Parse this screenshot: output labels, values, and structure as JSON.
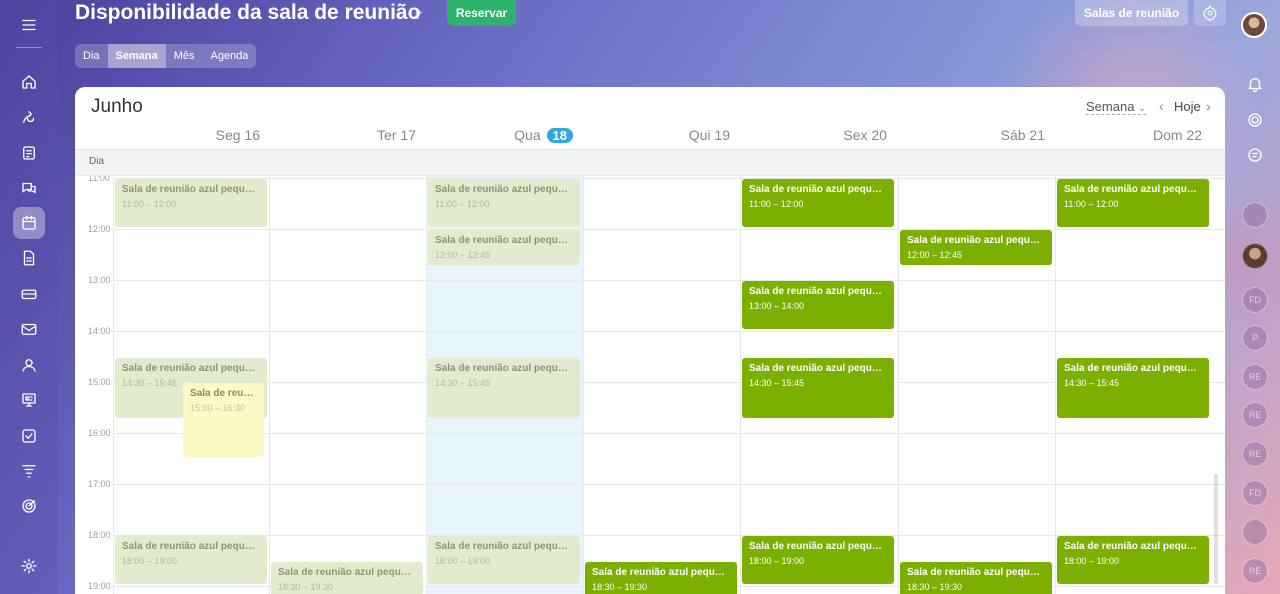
{
  "header": {
    "title": "Disponibilidade da sala de reunião",
    "reserve_label": "Reservar",
    "rooms_label": "Salas de reunião"
  },
  "view_tabs": [
    {
      "label": "Dia"
    },
    {
      "label": "Semana",
      "active": true
    },
    {
      "label": "Mês"
    },
    {
      "label": "Agenda"
    }
  ],
  "calendar": {
    "month": "Junho",
    "view_select": "Semana",
    "today_label": "Hoje",
    "allday_label": "Dia",
    "days": [
      {
        "name": "Seg",
        "num": "16"
      },
      {
        "name": "Ter",
        "num": "17"
      },
      {
        "name": "Qua",
        "num": "18",
        "today": true
      },
      {
        "name": "Qui",
        "num": "19"
      },
      {
        "name": "Sex",
        "num": "20"
      },
      {
        "name": "Sáb",
        "num": "21"
      },
      {
        "name": "Dom",
        "num": "22"
      }
    ],
    "hours": [
      "11:00",
      "12:00",
      "13:00",
      "14:00",
      "15:00",
      "16:00",
      "17:00",
      "18:00",
      "19:00"
    ],
    "events": [
      {
        "day": 0,
        "start": 11.0,
        "end": 12.0,
        "title": "Sala de reunião azul pequen...",
        "time": "11:00 – 12:00",
        "status": "past"
      },
      {
        "day": 2,
        "start": 11.0,
        "end": 12.0,
        "title": "Sala de reunião azul pequen...",
        "time": "11:00 – 12:00",
        "status": "past"
      },
      {
        "day": 4,
        "start": 11.0,
        "end": 12.0,
        "title": "Sala de reunião azul pequen...",
        "time": "11:00 – 12:00",
        "status": "green"
      },
      {
        "day": 6,
        "start": 11.0,
        "end": 12.0,
        "title": "Sala de reunião azul pequen...",
        "time": "11:00 – 12:00",
        "status": "green"
      },
      {
        "day": 2,
        "start": 12.0,
        "end": 12.75,
        "title": "Sala de reunião azul pequen...",
        "time": "12:00 – 12:45",
        "status": "past"
      },
      {
        "day": 5,
        "start": 12.0,
        "end": 12.75,
        "title": "Sala de reunião azul pequen...",
        "time": "12:00 – 12:45",
        "status": "green"
      },
      {
        "day": 4,
        "start": 13.0,
        "end": 14.0,
        "title": "Sala de reunião azul pequen...",
        "time": "13:00 – 14:00",
        "status": "green"
      },
      {
        "day": 0,
        "start": 14.5,
        "end": 15.75,
        "title": "Sala de reunião azul pequen...",
        "time": "14:30 – 15:45",
        "status": "past"
      },
      {
        "day": 2,
        "start": 14.5,
        "end": 15.75,
        "title": "Sala de reunião azul pequen...",
        "time": "14:30 – 15:45",
        "status": "past"
      },
      {
        "day": 4,
        "start": 14.5,
        "end": 15.75,
        "title": "Sala de reunião azul pequen...",
        "time": "14:30 – 15:45",
        "status": "green"
      },
      {
        "day": 6,
        "start": 14.5,
        "end": 15.75,
        "title": "Sala de reunião azul pequen...",
        "time": "14:30 – 15:45",
        "status": "green"
      },
      {
        "day": 0,
        "start": 15.0,
        "end": 16.5,
        "title": "Sala de reuni...",
        "time": "15:00 – 16:30",
        "status": "yellow",
        "overlap": true
      },
      {
        "day": 0,
        "start": 18.0,
        "end": 19.0,
        "title": "Sala de reunião azul pequen...",
        "time": "18:00 – 19:00",
        "status": "past"
      },
      {
        "day": 2,
        "start": 18.0,
        "end": 19.0,
        "title": "Sala de reunião azul pequen...",
        "time": "18:00 – 19:00",
        "status": "past"
      },
      {
        "day": 4,
        "start": 18.0,
        "end": 19.0,
        "title": "Sala de reunião azul pequen...",
        "time": "18:00 – 19:00",
        "status": "green"
      },
      {
        "day": 6,
        "start": 18.0,
        "end": 19.0,
        "title": "Sala de reunião azul pequen...",
        "time": "18:00 – 19:00",
        "status": "green"
      },
      {
        "day": 1,
        "start": 18.5,
        "end": 19.5,
        "title": "Sala de reunião azul pequen...",
        "time": "18:30 – 19:30",
        "status": "past"
      },
      {
        "day": 3,
        "start": 18.5,
        "end": 19.5,
        "title": "Sala de reunião azul pequen...",
        "time": "18:30 – 19:30",
        "status": "green"
      },
      {
        "day": 5,
        "start": 18.5,
        "end": 19.5,
        "title": "Sala de reunião azul pequen...",
        "time": "18:30 – 19:30",
        "status": "green"
      }
    ]
  },
  "left_rail_icons": [
    "menu-icon",
    "home-icon",
    "feed-icon",
    "tasks-icon",
    "chat-icon",
    "calendar-icon",
    "documents-icon",
    "crm-icon",
    "mail-icon",
    "contacts-icon",
    "sites-icon",
    "checklist-icon",
    "filter-icon",
    "goals-icon",
    "settings-icon"
  ],
  "right_rail": {
    "icons": [
      "bell-icon",
      "target-icon",
      "support-icon"
    ],
    "avatars": [
      "FD",
      "P",
      "RE",
      "RE",
      "RE",
      "FD",
      "RE"
    ]
  },
  "colors": {
    "event_green": "#7cb000",
    "event_past": "#e3ebcf",
    "event_yellow": "#fdf9c5",
    "today_badge": "#2fa7e0",
    "reserve_button": "#2db36b"
  }
}
